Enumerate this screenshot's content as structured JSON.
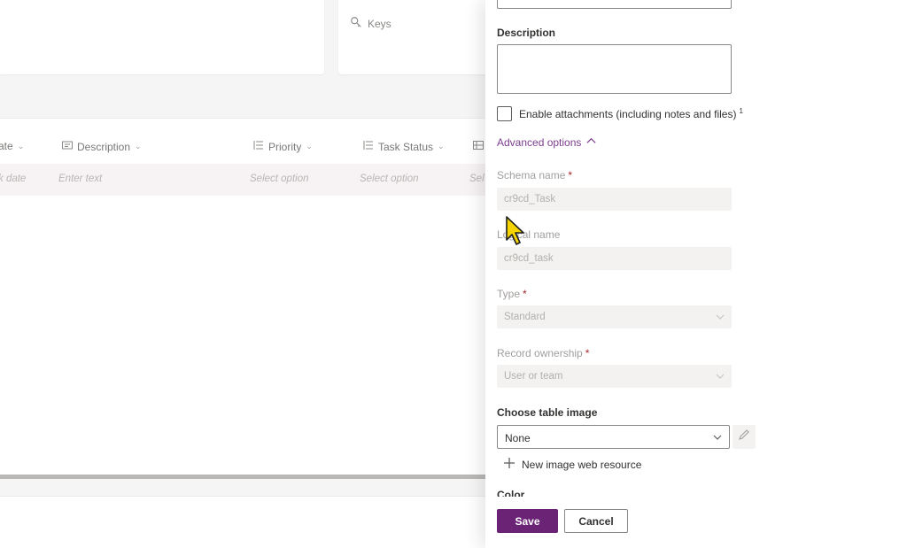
{
  "background": {
    "keys_label": "Keys",
    "columns": [
      {
        "label": "ate",
        "icon": "calendar-icon",
        "placeholder": "k date"
      },
      {
        "label": "Description",
        "icon": "text-field-icon",
        "placeholder": "Enter text"
      },
      {
        "label": "Priority",
        "icon": "choice-list-icon",
        "placeholder": "Select option"
      },
      {
        "label": "Task Status",
        "icon": "choice-list-icon",
        "placeholder": "Select option"
      },
      {
        "label": "",
        "icon": "table-icon",
        "placeholder": "Sel"
      }
    ]
  },
  "panel": {
    "description_label": "Description",
    "attachments_label": "Enable attachments (including notes and files)",
    "attachments_sup": "1",
    "advanced_options_label": "Advanced options",
    "schema_name_label": "Schema name",
    "schema_name_value": "cr9cd_Task",
    "logical_name_label": "Logical name",
    "logical_name_value": "cr9cd_task",
    "type_label": "Type",
    "type_value": "Standard",
    "ownership_label": "Record ownership",
    "ownership_value": "User or team",
    "table_image_label": "Choose table image",
    "table_image_value": "None",
    "new_image_label": "New image web resource",
    "color_label": "Color",
    "required_marker": "*",
    "save_label": "Save",
    "cancel_label": "Cancel"
  },
  "colors": {
    "accent": "#6b2376",
    "link": "#7b3e8d",
    "required": "#a4262c"
  }
}
